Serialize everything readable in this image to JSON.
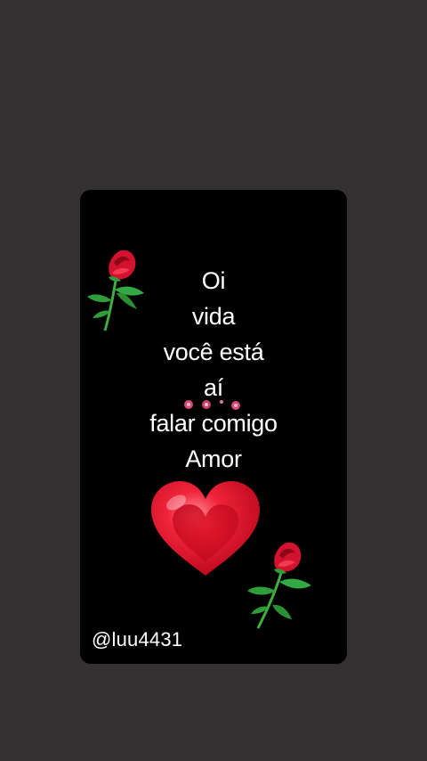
{
  "card": {
    "lines": [
      "Oi",
      "vida",
      "você está",
      "aí",
      "falar comigo",
      "Amor"
    ],
    "handle": "@luu4431"
  },
  "icons": {
    "top_decoration": "rose-icon",
    "bottom_decoration": "rose-icon",
    "center_decoration": "heart-icon",
    "sparkle": "flower-dots-icon"
  },
  "colors": {
    "background": "#333132",
    "card": "#000000",
    "text": "#ffffff",
    "heart": "#e8182c",
    "rose": "#d2122e",
    "leaf": "#2ea043"
  }
}
